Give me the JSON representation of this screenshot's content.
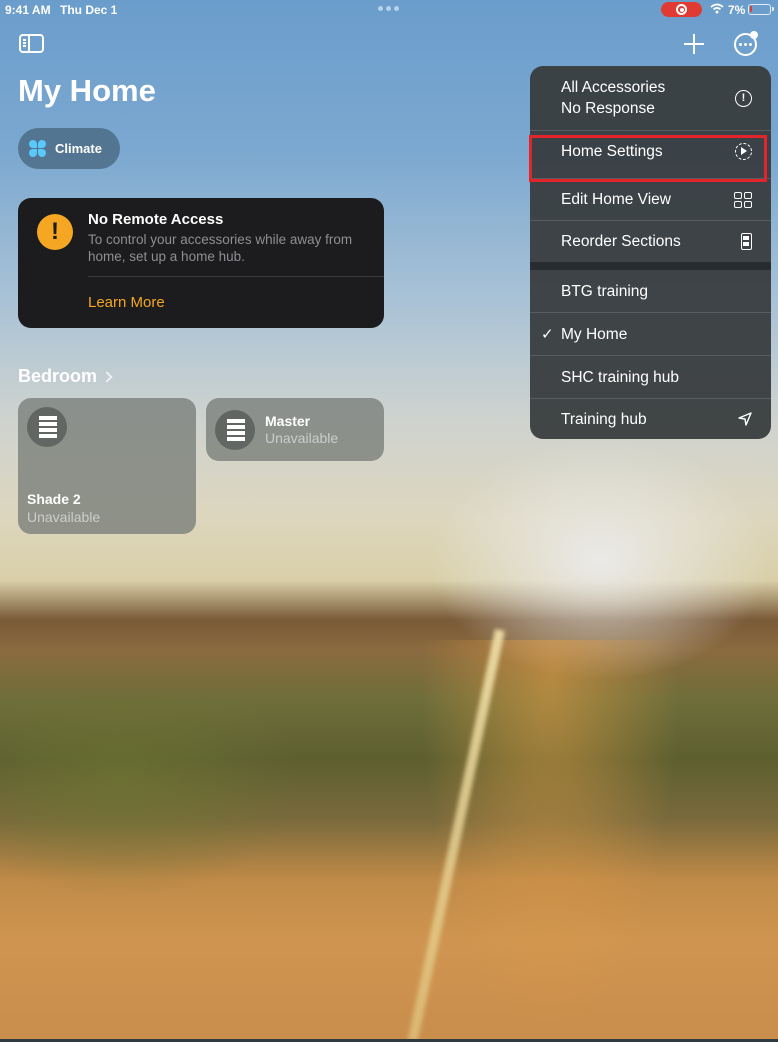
{
  "status_bar": {
    "time": "9:41 AM",
    "date": "Thu Dec 1",
    "battery_percent": "7%",
    "recording": true,
    "icons": [
      "multitask-dots",
      "record-indicator-icon",
      "wifi-icon",
      "battery-icon"
    ]
  },
  "toolbar": {
    "sidebar_toggle": "sidebar-toggle-icon",
    "add": "plus-icon",
    "more": "ellipsis-circle-icon"
  },
  "page": {
    "title": "My Home"
  },
  "chips": [
    {
      "label": "Climate",
      "icon": "fan-icon",
      "icon_color": "#5ac8fa"
    }
  ],
  "alert": {
    "icon": "exclamation-icon",
    "icon_color": "#f5a623",
    "title": "No Remote Access",
    "body": "To control your accessories while away from home, set up a home hub.",
    "link": "Learn More",
    "link_color": "#f5a623"
  },
  "rooms": [
    {
      "name": "Bedroom",
      "accessories": [
        {
          "name": "Shade 2",
          "status": "Unavailable",
          "icon": "window-shade-icon"
        },
        {
          "name": "Master",
          "status": "Unavailable",
          "icon": "window-shade-icon"
        }
      ]
    }
  ],
  "menu": {
    "items": [
      {
        "label_line1": "All Accessories",
        "label_line2": "No Response",
        "icon": "info-icon"
      },
      {
        "label": "Home Settings",
        "icon": "gear-icon",
        "highlighted": true
      },
      {
        "label": "Edit Home View",
        "icon": "grid-icon"
      },
      {
        "label": "Reorder Sections",
        "icon": "reorder-icon"
      }
    ],
    "homes": [
      {
        "label": "BTG training",
        "selected": false
      },
      {
        "label": "My Home",
        "selected": true
      },
      {
        "label": "SHC training hub",
        "selected": false
      },
      {
        "label": "Training hub",
        "selected": false,
        "icon": "location-arrow-icon"
      }
    ],
    "check_glyph": "✓",
    "highlight_color": "#e3242b"
  }
}
